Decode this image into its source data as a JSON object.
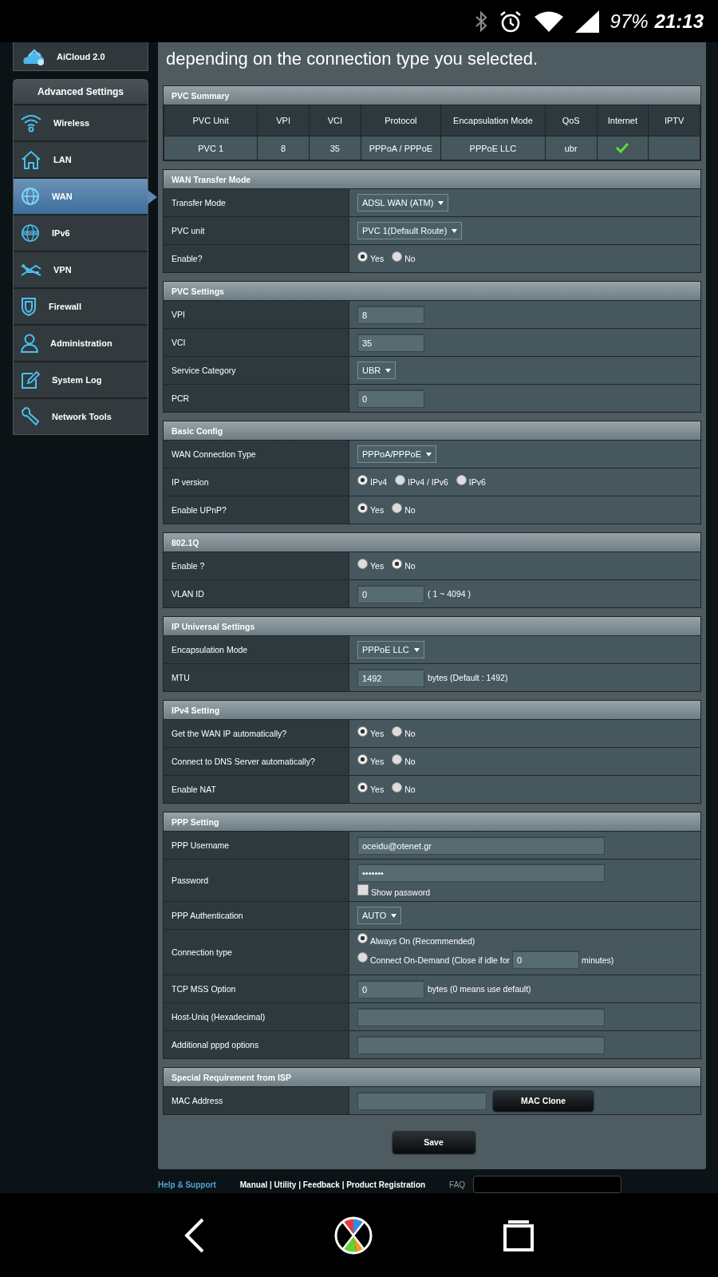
{
  "status_bar": {
    "battery": "97%",
    "time": "21:13"
  },
  "sidebar": {
    "top_item": {
      "label": "AiCloud 2.0"
    },
    "header": "Advanced Settings",
    "items": [
      {
        "label": "Wireless",
        "selected": false
      },
      {
        "label": "LAN",
        "selected": false
      },
      {
        "label": "WAN",
        "selected": true
      },
      {
        "label": "IPv6",
        "selected": false
      },
      {
        "label": "VPN",
        "selected": false
      },
      {
        "label": "Firewall",
        "selected": false
      },
      {
        "label": "Administration",
        "selected": false
      },
      {
        "label": "System Log",
        "selected": false
      },
      {
        "label": "Network Tools",
        "selected": false
      }
    ]
  },
  "intro": "depending on the connection type you selected.",
  "summary": {
    "title": "PVC Summary",
    "columns": [
      "PVC Unit",
      "VPI",
      "VCI",
      "Protocol",
      "Encapsulation Mode",
      "QoS",
      "Internet",
      "IPTV"
    ],
    "rows": [
      {
        "cells": [
          "PVC 1",
          "8",
          "35",
          "PPPoA / PPPoE",
          "PPPoE LLC",
          "ubr"
        ],
        "internet": true
      }
    ]
  },
  "sections": [
    {
      "title": "WAN Transfer Mode",
      "rows": [
        {
          "label": "Transfer Mode",
          "kind": "select",
          "value": "ADSL WAN (ATM)"
        },
        {
          "label": "PVC unit",
          "kind": "select",
          "value": "PVC 1(Default Route)"
        },
        {
          "label": "Enable?",
          "kind": "radio",
          "options": [
            {
              "label": "Yes",
              "selected": true
            },
            {
              "label": "No",
              "selected": false
            }
          ]
        }
      ]
    },
    {
      "title": "PVC Settings",
      "rows": [
        {
          "label": "VPI",
          "kind": "input",
          "value": "8"
        },
        {
          "label": "VCI",
          "kind": "input",
          "value": "35"
        },
        {
          "label": "Service Category",
          "kind": "select",
          "value": "UBR"
        },
        {
          "label": "PCR",
          "kind": "input",
          "value": "0"
        }
      ]
    },
    {
      "title": "Basic Config",
      "rows": [
        {
          "label": "WAN Connection Type",
          "kind": "select",
          "value": "PPPoA/PPPoE"
        },
        {
          "label": "IP version",
          "kind": "radio",
          "options": [
            {
              "label": "IPv4",
              "selected": true
            },
            {
              "label": "IPv4 / IPv6",
              "selected": false
            },
            {
              "label": "IPv6",
              "selected": false
            }
          ]
        },
        {
          "label": "Enable UPnP?",
          "kind": "radio",
          "options": [
            {
              "label": "Yes",
              "selected": true
            },
            {
              "label": "No",
              "selected": false
            }
          ]
        }
      ]
    },
    {
      "title": "802.1Q",
      "rows": [
        {
          "label": "Enable ?",
          "kind": "radio",
          "options": [
            {
              "label": "Yes",
              "selected": false
            },
            {
              "label": "No",
              "selected": true
            }
          ]
        },
        {
          "label": "VLAN ID",
          "kind": "input",
          "value": "0",
          "suffix": "( 1 ~ 4094 )"
        }
      ]
    },
    {
      "title": "IP Universal Settings",
      "rows": [
        {
          "label": "Encapsulation Mode",
          "kind": "select",
          "value": "PPPoE LLC"
        },
        {
          "label": "MTU",
          "kind": "input",
          "value": "1492",
          "suffix": "bytes (Default : 1492)"
        }
      ]
    },
    {
      "title": "IPv4 Setting",
      "rows": [
        {
          "label": "Get the WAN IP automatically?",
          "kind": "radio",
          "options": [
            {
              "label": "Yes",
              "selected": true
            },
            {
              "label": "No",
              "selected": false
            }
          ]
        },
        {
          "label": "Connect to DNS Server automatically?",
          "kind": "radio",
          "options": [
            {
              "label": "Yes",
              "selected": true
            },
            {
              "label": "No",
              "selected": false
            }
          ]
        },
        {
          "label": "Enable NAT",
          "kind": "radio",
          "options": [
            {
              "label": "Yes",
              "selected": true
            },
            {
              "label": "No",
              "selected": false
            }
          ]
        }
      ]
    },
    {
      "title": "PPP Setting",
      "rows": [
        {
          "label": "PPP Username",
          "kind": "wide_input",
          "value": "oceidu@otenet.gr"
        },
        {
          "label": "Password",
          "kind": "password",
          "value": "•••••••",
          "checkbox": {
            "label": "Show password",
            "checked": false
          }
        },
        {
          "label": "PPP Authentication",
          "kind": "select",
          "value": "AUTO"
        },
        {
          "label": "Connection type",
          "kind": "radio_list",
          "options": [
            {
              "label": "Always On (Recommended)",
              "selected": true
            },
            {
              "label": "Connect On-Demand (Close if idle for",
              "selected": false,
              "input": "0",
              "suffix": "minutes)"
            }
          ]
        },
        {
          "label": "TCP MSS Option",
          "kind": "input",
          "value": "0",
          "suffix": "bytes (0 means use default)"
        },
        {
          "label": "Host-Uniq (Hexadecimal)",
          "kind": "wide_input"
        },
        {
          "label": "Additional pppd options",
          "kind": "wide_input"
        }
      ]
    },
    {
      "title": "Special Requirement from ISP",
      "rows": [
        {
          "label": "MAC Address",
          "kind": "mac",
          "button": "MAC Clone"
        }
      ]
    }
  ],
  "save_button": "Save",
  "footer": {
    "help": "Help & Support",
    "links": "Manual | Utility | Feedback | Product Registration",
    "faq": "FAQ"
  }
}
